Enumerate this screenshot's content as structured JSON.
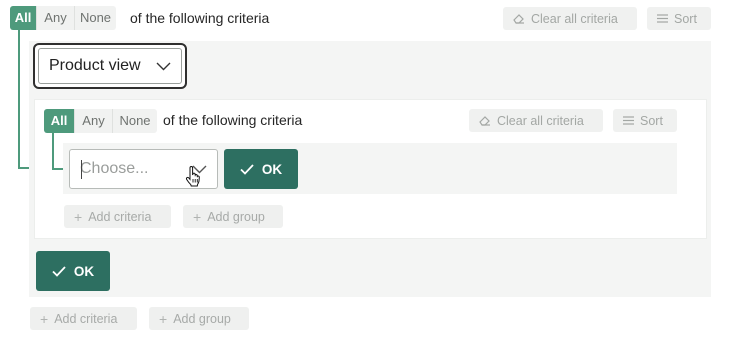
{
  "outer": {
    "segment": {
      "all": "All",
      "any": "Any",
      "none": "None",
      "selected": "All"
    },
    "criteria_text": "of the following criteria",
    "clear_label": "Clear all criteria",
    "sort_label": "Sort",
    "add_criteria": "Add criteria",
    "add_group": "Add group",
    "ok_label": "OK"
  },
  "group": {
    "field_value": "Product view",
    "segment": {
      "all": "All",
      "any": "Any",
      "none": "None",
      "selected": "All"
    },
    "criteria_text": "of the following criteria",
    "clear_label": "Clear all criteria",
    "sort_label": "Sort",
    "choose_placeholder": "Choose...",
    "ok_label": "OK",
    "add_criteria": "Add criteria",
    "add_group": "Add group"
  },
  "colors": {
    "accent": "#4e9a7c",
    "ok_button": "#2d6f61",
    "panel_bg": "#f4f5f4",
    "ghost_bg": "#f0f1f0"
  },
  "icons": {
    "clear": "eraser-icon",
    "sort": "list-lines-icon",
    "ok": "checkmark-icon",
    "add": "plus-icon",
    "dropdown": "chevron-down-icon",
    "cursor": "hand-pointer-icon"
  }
}
